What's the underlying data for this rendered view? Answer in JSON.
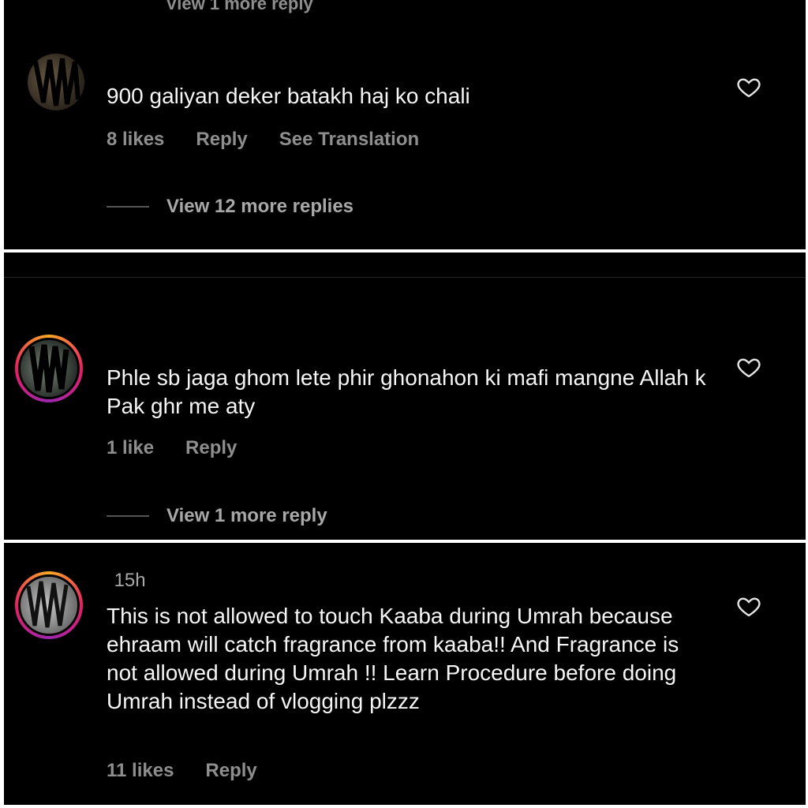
{
  "comments": [
    {
      "top_partial": "View 1 more reply",
      "username": "",
      "text": "900 galiyan deker batakh haj ko chali",
      "likes": "8 likes",
      "reply": "Reply",
      "translate": "See Translation",
      "view_replies": "View 12 more replies"
    },
    {
      "username": "",
      "text": "Phle sb jaga ghom lete phir ghonahon ki mafi mangne Allah k Pak ghr me aty",
      "likes": "1 like",
      "reply": "Reply",
      "view_replies": "View 1 more reply"
    },
    {
      "username": "",
      "timestamp": "15h",
      "text": "This is not allowed to touch Kaaba during Umrah because ehraam will catch fragrance from kaaba!! And Fragrance is not allowed during Umrah !! Learn Procedure before doing Umrah instead of vlogging plzzz",
      "likes": "11 likes",
      "reply": "Reply"
    }
  ],
  "icons": {
    "like": "heart-outline-icon",
    "avatar": "profile-avatar"
  },
  "colors": {
    "background": "#000000",
    "text": "#f5f5f5",
    "muted": "#8e8e8e",
    "story_ring": "#e91e63"
  }
}
